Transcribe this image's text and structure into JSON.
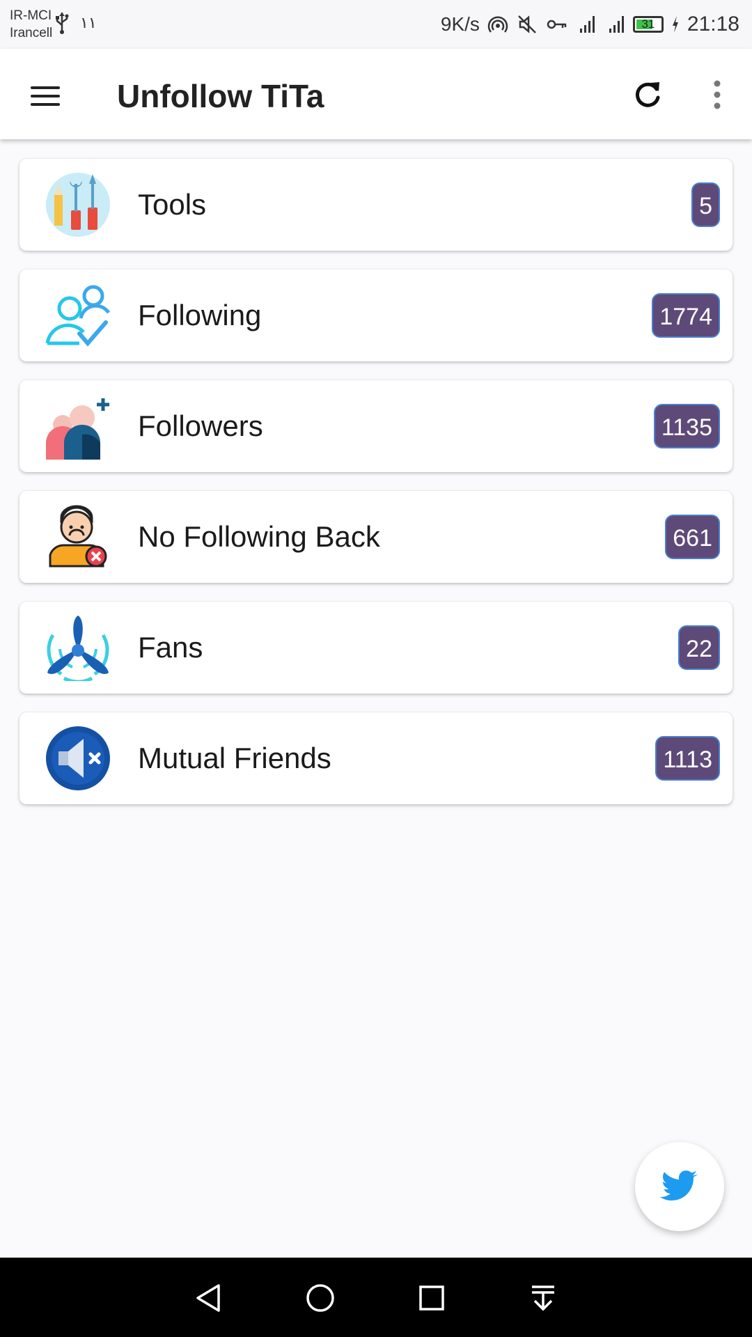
{
  "status_bar": {
    "carrier_1": "IR-MCI",
    "carrier_2": "Irancell",
    "extra": "١١",
    "network_speed": "9K/s",
    "battery_level": "31",
    "time": "21:18",
    "icons": [
      "usb-icon",
      "hotspot-icon",
      "mute-icon",
      "vpn-key-icon",
      "signal-2g-icon",
      "signal-4g-icon",
      "battery-icon",
      "charging-icon"
    ]
  },
  "app_bar": {
    "title": "Unfollow TiTa",
    "icons": [
      "menu-icon",
      "refresh-icon",
      "more-vert-icon"
    ]
  },
  "menu": {
    "items": [
      {
        "label": "Tools",
        "count": "5",
        "icon": "tools-icon"
      },
      {
        "label": "Following",
        "count": "1774",
        "icon": "following-users-icon"
      },
      {
        "label": "Followers",
        "count": "1135",
        "icon": "followers-icon"
      },
      {
        "label": "No Following Back",
        "count": "661",
        "icon": "sad-user-icon"
      },
      {
        "label": "Fans",
        "count": "22",
        "icon": "fan-icon"
      },
      {
        "label": "Mutual Friends",
        "count": "1113",
        "icon": "mute-speaker-icon"
      }
    ]
  },
  "fab": {
    "icon": "twitter-bird-icon"
  },
  "nav_bar": {
    "icons": [
      "back-icon",
      "home-icon",
      "recents-icon",
      "notification-pull-icon"
    ]
  },
  "colors": {
    "badge": "#5e4a78",
    "badge_border": "#4a7fd0",
    "twitter": "#1d9bf0",
    "background": "#faf9fc"
  }
}
